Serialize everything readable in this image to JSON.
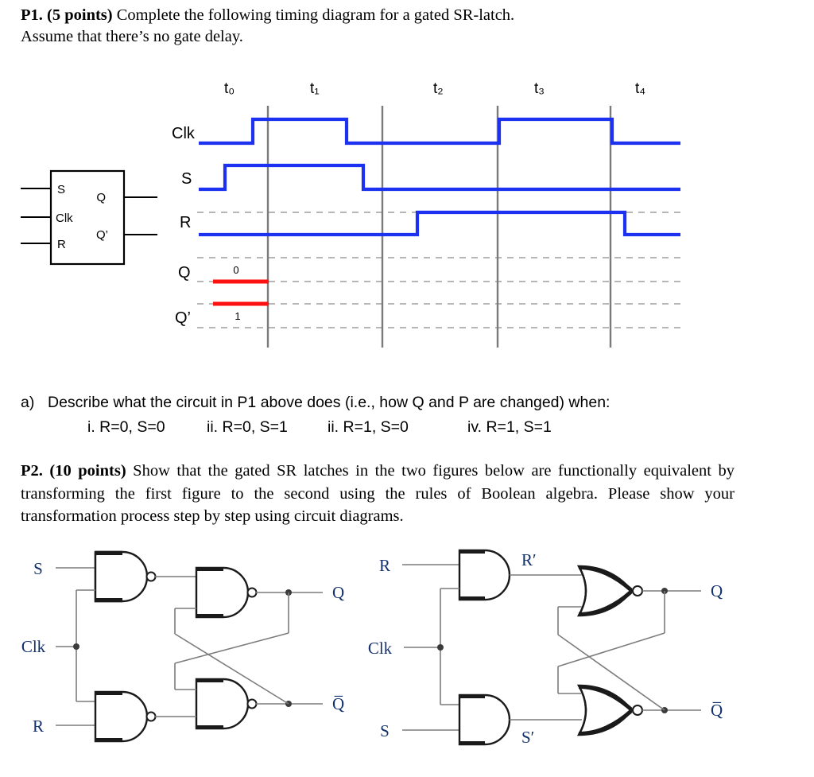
{
  "p1": {
    "number": "P1.",
    "points": "(5 points)",
    "text_line1": " Complete the following timing diagram for a gated SR-latch.",
    "text_line2": "Assume that there’s no gate delay."
  },
  "latch_block": {
    "inputs": [
      "S",
      "Clk",
      "R"
    ],
    "outputs": [
      "Q",
      "Q’"
    ]
  },
  "timing": {
    "time_labels": [
      "t₀",
      "t₁",
      "t₂",
      "t₃",
      "t₄"
    ],
    "signal_labels": [
      "Clk",
      "S",
      "R",
      "Q",
      "Q’"
    ],
    "annotations": {
      "q_value": "0",
      "qn_value": "1"
    },
    "colors": {
      "waveform": "#1d31f0",
      "answer": "#fc1111",
      "gridline": "#808080",
      "level_dash": "#b4b4b4"
    }
  },
  "part_a": {
    "marker": "a)",
    "prompt": "Describe what the circuit in P1 above does (i.e., how Q and P are changed) when:",
    "cases": [
      "i. R=0, S=0",
      "ii. R=0, S=1",
      "ii. R=1, S=0",
      "iv. R=1, S=1"
    ]
  },
  "p2": {
    "number": "P2.",
    "points": "(10 points)",
    "text": " Show that the gated SR latches in the two figures below are functionally equivalent by transforming the first figure to the second using the rules of Boolean algebra. Please show your transformation process step by step using circuit diagrams."
  },
  "circuit_left": {
    "inputs": [
      "S",
      "Clk",
      "R"
    ],
    "outputs": [
      "Q",
      "Q̅"
    ],
    "gate_type": "nand"
  },
  "circuit_right": {
    "inputs": [
      "R",
      "Clk",
      "S"
    ],
    "internal": [
      "R′",
      "S′"
    ],
    "outputs": [
      "Q",
      "Q̅"
    ],
    "gate_type_input": "and",
    "gate_type_cross": "nor"
  }
}
